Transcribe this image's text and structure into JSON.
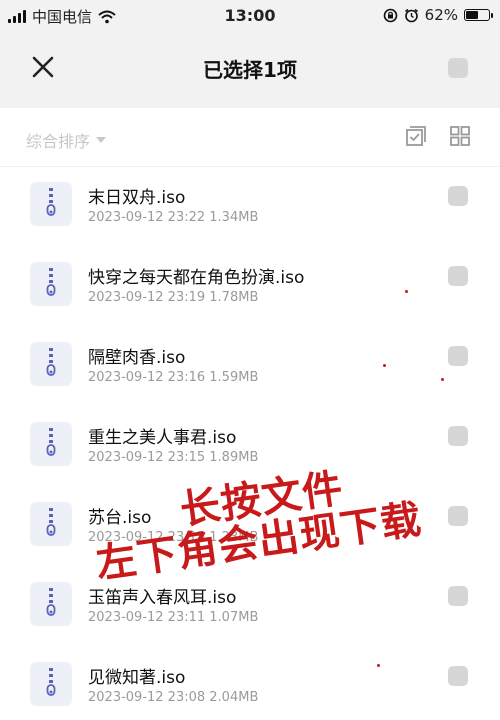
{
  "status_bar": {
    "carrier": "中国电信",
    "time": "13:00",
    "battery": "62%",
    "battery_level": 0.62
  },
  "header": {
    "title": "已选择1项"
  },
  "toolbar": {
    "sort_label": "综合排序"
  },
  "files": [
    {
      "name": "末日双舟.iso",
      "meta": "2023-09-12 23:22  1.34MB"
    },
    {
      "name": "快穿之每天都在角色扮演.iso",
      "meta": "2023-09-12 23:19  1.78MB"
    },
    {
      "name": "隔壁肉香.iso",
      "meta": "2023-09-12 23:16  1.59MB"
    },
    {
      "name": "重生之美人事君.iso",
      "meta": "2023-09-12 23:15  1.89MB"
    },
    {
      "name": "苏台.iso",
      "meta": "2023-09-12 23:13  1.23MB"
    },
    {
      "name": "玉笛声入春风耳.iso",
      "meta": "2023-09-12 23:11  1.07MB"
    },
    {
      "name": "见微知著.iso",
      "meta": "2023-09-12 23:08  2.04MB"
    }
  ],
  "annotation": {
    "line1": "长按文件",
    "line2": "左下角会出现下载"
  },
  "colors": {
    "accent": "#5b63b7",
    "icon_bg": "#eef0f8",
    "annotation": "#c81a1a"
  }
}
